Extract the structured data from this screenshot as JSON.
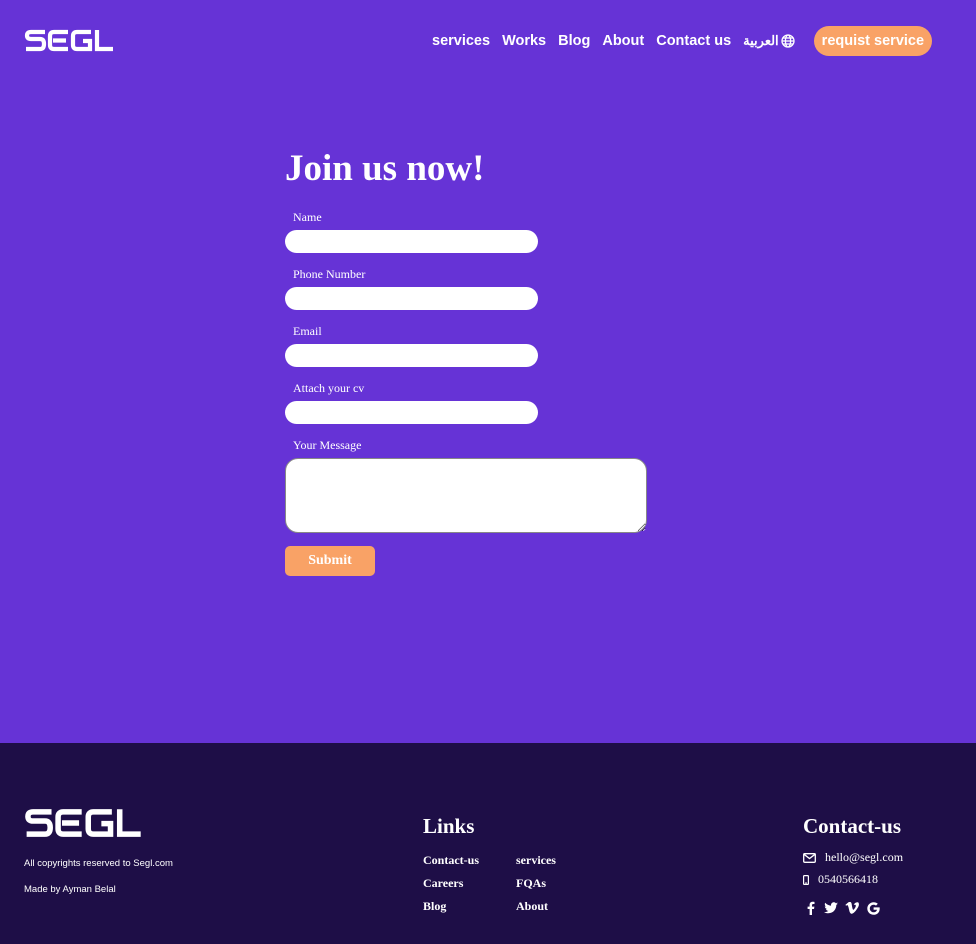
{
  "header": {
    "logo_text": "SEGL",
    "nav": [
      {
        "label": "services"
      },
      {
        "label": "Works"
      },
      {
        "label": "Blog"
      },
      {
        "label": "About"
      },
      {
        "label": "Contact us"
      }
    ],
    "language": "العربية",
    "cta": "requist service"
  },
  "form": {
    "title": "Join us now!",
    "fields": {
      "name": "Name",
      "phone": "Phone Number",
      "email": "Email",
      "cv": "Attach your cv",
      "message": "Your Message"
    },
    "submit": "Submit"
  },
  "footer": {
    "logo_text": "SEGL",
    "copyright": "All copyrights reserved to Segl.com",
    "made_by": "Made by Ayman Belal",
    "links_title": "Links",
    "links": [
      "Contact-us",
      "services",
      "Careers",
      "FQAs",
      "Blog",
      "About"
    ],
    "contact_title": "Contact-us",
    "email": "hello@segl.com",
    "phone": "0540566418",
    "social": [
      "facebook-icon",
      "twitter-icon",
      "vimeo-icon",
      "google-icon"
    ]
  },
  "colors": {
    "background": "#6633d6",
    "accent": "#f9a266",
    "footer": "#1e0e47"
  }
}
